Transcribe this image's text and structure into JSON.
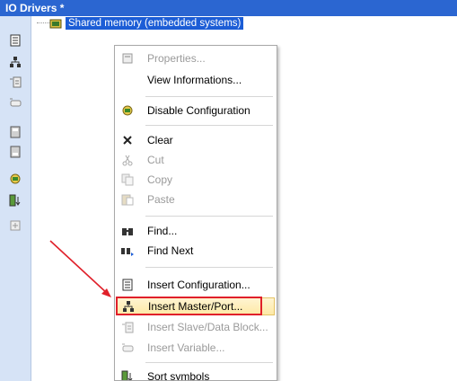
{
  "window": {
    "title": "IO Drivers *"
  },
  "tree": {
    "node_label": "Shared memory (embedded systems)"
  },
  "menu": {
    "items": [
      {
        "id": "properties",
        "label": "Properties...",
        "icon": "properties-icon",
        "enabled": false
      },
      {
        "id": "view-informations",
        "label": "View Informations...",
        "icon": "",
        "enabled": true
      },
      {
        "id": "disable-configuration",
        "label": "Disable Configuration",
        "icon": "disable-config-icon",
        "enabled": true
      },
      {
        "id": "clear",
        "label": "Clear",
        "icon": "close-x-icon",
        "enabled": true
      },
      {
        "id": "cut",
        "label": "Cut",
        "icon": "scissors-icon",
        "enabled": false
      },
      {
        "id": "copy",
        "label": "Copy",
        "icon": "copy-icon",
        "enabled": false
      },
      {
        "id": "paste",
        "label": "Paste",
        "icon": "paste-icon",
        "enabled": false
      },
      {
        "id": "find",
        "label": "Find...",
        "icon": "binoculars-icon",
        "enabled": true
      },
      {
        "id": "find-next",
        "label": "Find Next",
        "icon": "binoculars-next-icon",
        "enabled": true
      },
      {
        "id": "insert-configuration",
        "label": "Insert Configuration...",
        "icon": "insert-configuration-icon",
        "enabled": true
      },
      {
        "id": "insert-master-port",
        "label": "Insert Master/Port...",
        "icon": "insert-master-icon",
        "enabled": true,
        "highlighted": true
      },
      {
        "id": "insert-slave-data-block",
        "label": "Insert Slave/Data Block...",
        "icon": "insert-slave-icon",
        "enabled": false
      },
      {
        "id": "insert-variable",
        "label": "Insert Variable...",
        "icon": "insert-variable-icon",
        "enabled": false
      },
      {
        "id": "sort-symbols",
        "label": "Sort symbols",
        "icon": "sort-icon",
        "enabled": true
      }
    ]
  },
  "colors": {
    "title_bar": "#2b66d1",
    "selection": "#1c5dd6",
    "hover_fill": "#fde9a6",
    "callout": "#e0202a"
  }
}
